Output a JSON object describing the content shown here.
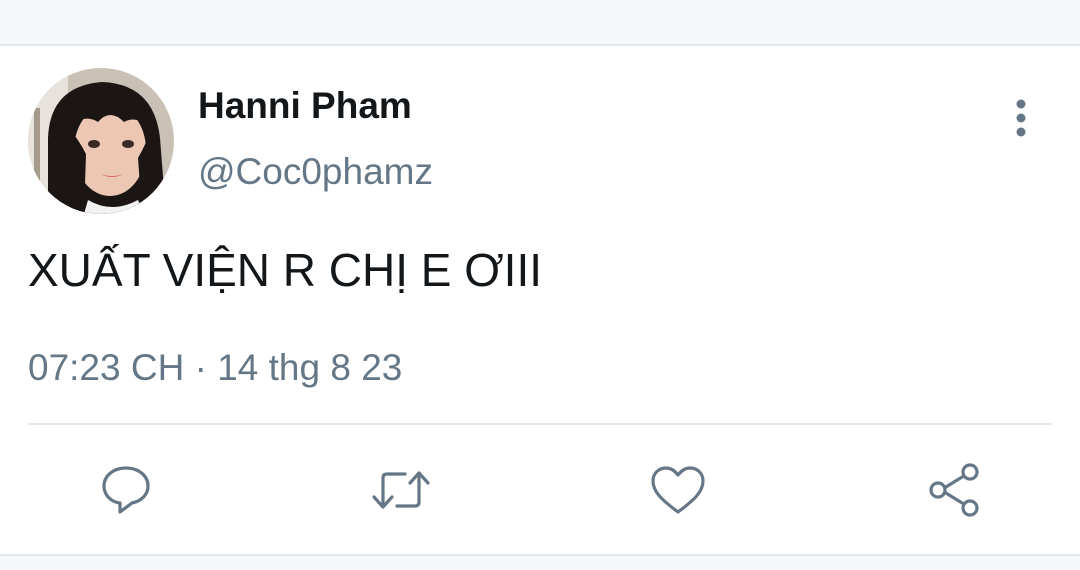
{
  "tweet": {
    "display_name": "Hanni Pham",
    "handle": "@Coc0phamz",
    "text": "XUẤT VIỆN R CHỊ E ƠIII",
    "time": "07:23 CH",
    "separator": "·",
    "date": "14 thg 8 23"
  },
  "icons": {
    "more": "more-vertical-icon",
    "reply": "reply-icon",
    "retweet": "retweet-icon",
    "like": "heart-icon",
    "share": "share-icon"
  },
  "colors": {
    "name": "#14171a",
    "secondary": "#657786",
    "divider": "#e1e8ed",
    "background": "#f5f8fa"
  }
}
